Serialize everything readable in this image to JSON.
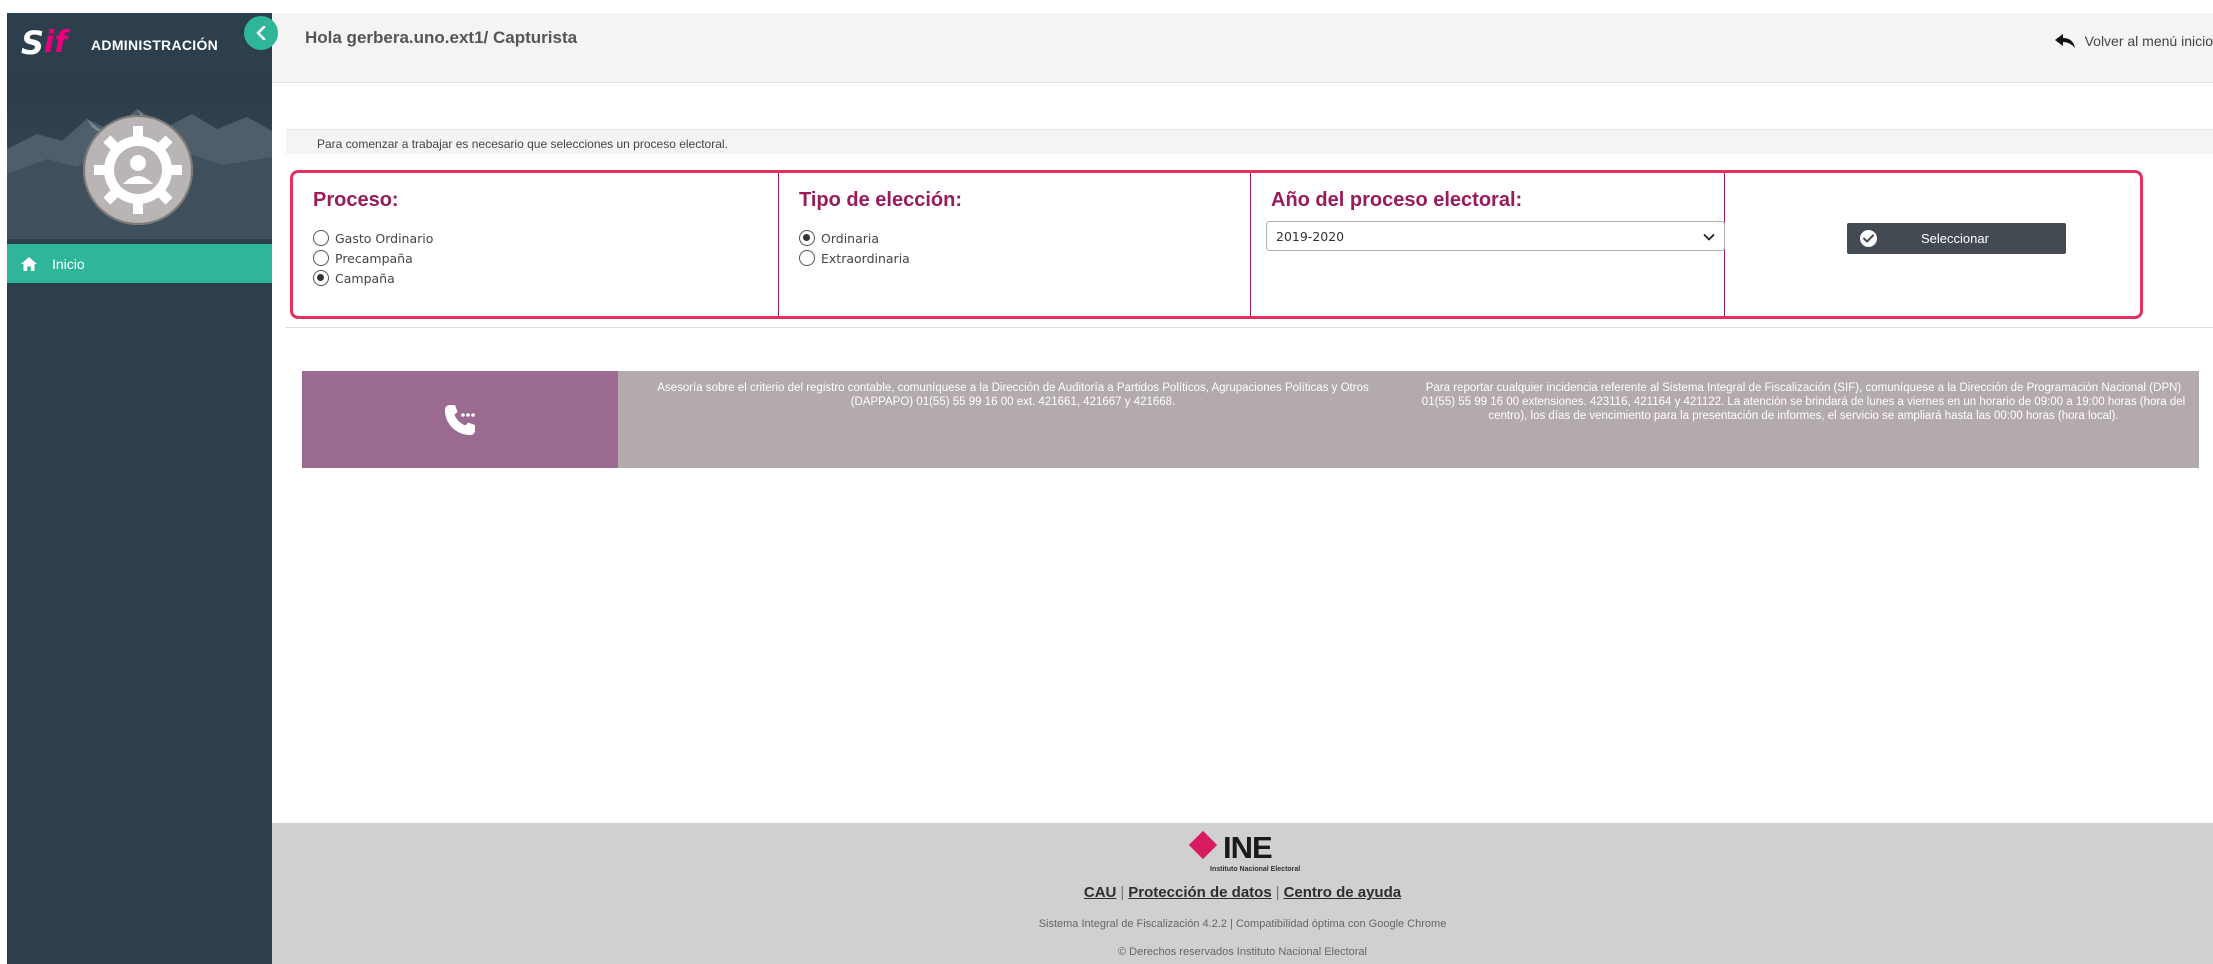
{
  "brand": {
    "logo_s": "S",
    "logo_if": "if",
    "title": "ADMINISTRACIÓN"
  },
  "header": {
    "greeting": "Hola gerbera.uno.ext1/ Capturista",
    "back_link": "Volver al menú inicio"
  },
  "sidebar": {
    "items": [
      {
        "label": "Inicio",
        "icon": "home-icon",
        "active": true
      }
    ]
  },
  "notice": "Para comenzar a trabajar es necesario que selecciones un proceso electoral.",
  "proceso": {
    "title": "Proceso:",
    "options": [
      "Gasto Ordinario",
      "Precampaña",
      "Campaña"
    ],
    "selected": "Campaña"
  },
  "tipo": {
    "title": "Tipo de elección:",
    "options": [
      "Ordinaria",
      "Extraordinaria"
    ],
    "selected": "Ordinaria"
  },
  "anio": {
    "title": "Año del proceso electoral:",
    "selected": "2019-2020"
  },
  "select_button": {
    "label": "Seleccionar"
  },
  "contact": {
    "left": "Asesoría sobre el criterio del registro contable, comuníquese a la Dirección de Auditoría a Partidos Políticos, Agrupaciones Políticas y Otros (DAPPAPO) 01(55) 55 99 16 00 ext. 421661, 421667 y 421668.",
    "right": "Para reportar cualquier incidencia referente al Sistema Integral de Fiscalización (SIF), comuníquese a la Dirección de Programación Nacional (DPN) 01(55) 55 99 16 00 extensiones. 423116, 421164 y 421122. La atención se brindará de lunes a viernes en un horario de 09:00 a 19:00 horas (hora del centro), los días de vencimiento para la presentación de informes, el servicio se ampliará hasta las 00:00 horas (hora local)."
  },
  "footer": {
    "logo_text": "INE",
    "logo_sub": "Instituto Nacional Electoral",
    "links": [
      "CAU",
      "Protección de datos",
      "Centro de ayuda"
    ],
    "version": "Sistema Integral de Fiscalización 4.2.2 | Compatibilidad óptima con Google Chrome",
    "copyright": "© Derechos reservados Instituto Nacional Electoral"
  },
  "colors": {
    "sidebar_bg": "#2d3e4d",
    "accent_green": "#2fb59a",
    "brand_magenta": "#9b1a5a",
    "highlight_border": "#e6305f",
    "banner_purple": "#9b6a91",
    "banner_gray": "#b2aaae"
  }
}
